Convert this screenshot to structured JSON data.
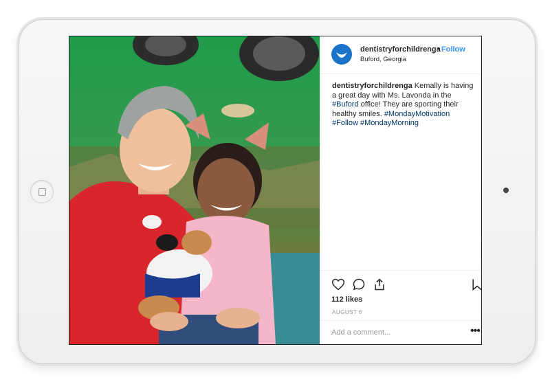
{
  "post": {
    "username": "dentistryforchildrenga",
    "follow_separator": "•",
    "follow_label": "Follow",
    "location": "Buford, Georgia",
    "caption_user": "dentistryforchildrenga",
    "caption_text_1": " Kemally is having a great day with Ms. Lavonda in the ",
    "caption_tag_1": "#Buford",
    "caption_text_2": " office! They are sporting their healthy smiles. ",
    "caption_tag_2": "#MondayMotivation",
    "caption_tag_3": "#Follow",
    "caption_tag_4": "#MondayMorning",
    "likes": "112 likes",
    "date": "AUGUST 6",
    "comment_placeholder": "Add a comment...",
    "more_label": "•••"
  },
  "icons": {
    "avatar": "brand-avatar-icon",
    "like": "heart-icon",
    "comment": "comment-icon",
    "share": "share-icon",
    "save": "bookmark-icon"
  },
  "colors": {
    "link": "#3897f0",
    "hashtag": "#003569",
    "avatar": "#1a73c9"
  }
}
